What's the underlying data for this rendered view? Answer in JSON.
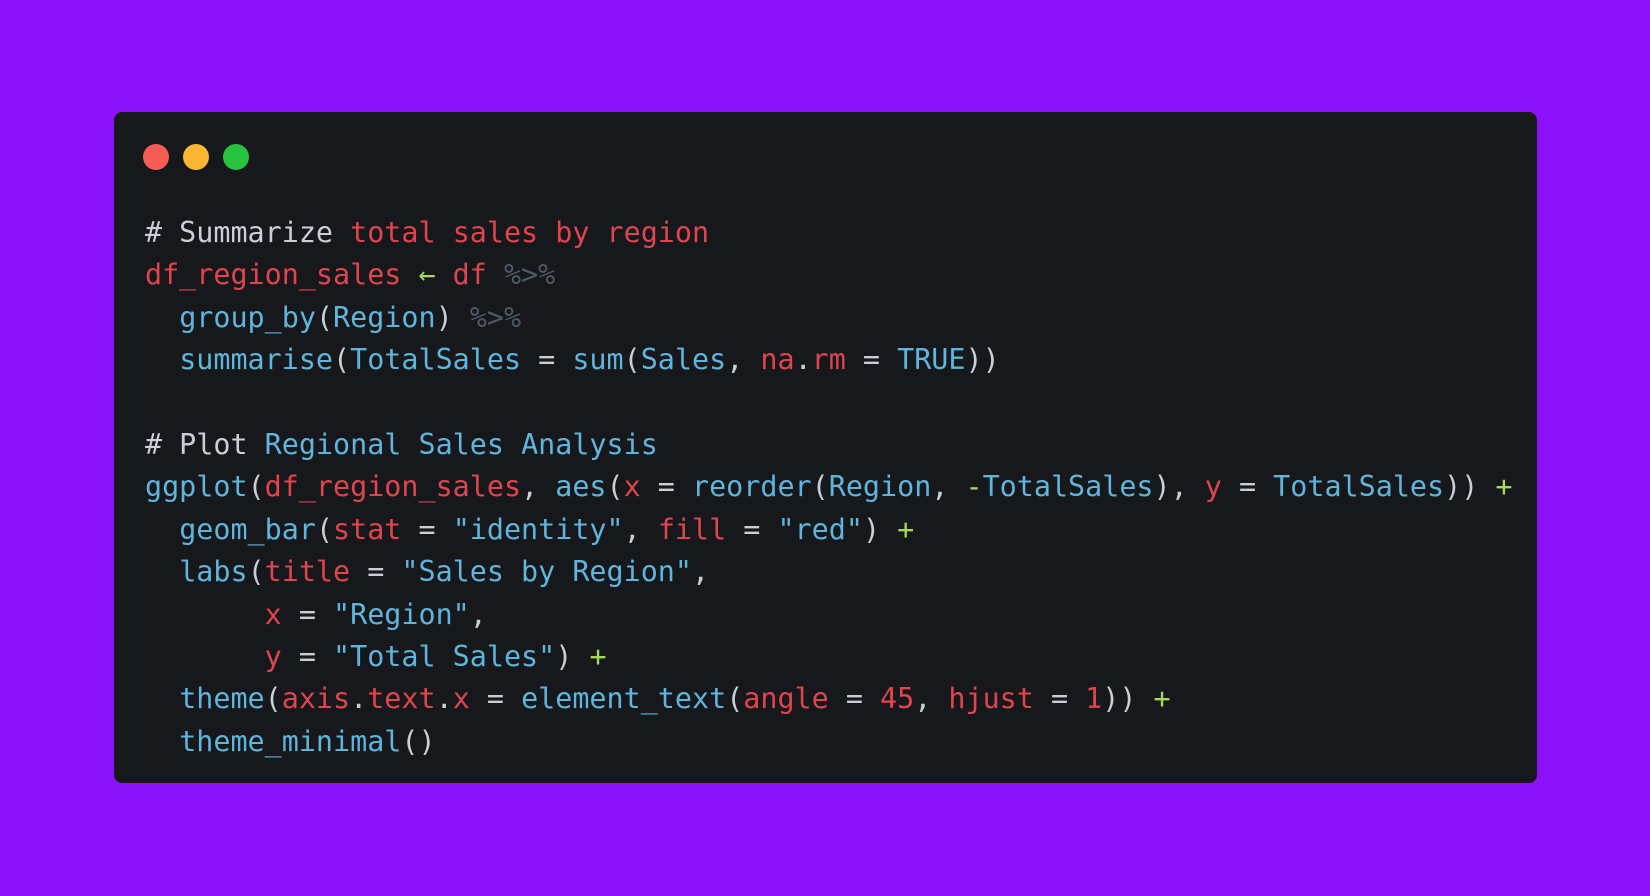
{
  "colors": {
    "background": "#8b12fb",
    "window": "#16181b",
    "dot_close": "#f85d55",
    "dot_minimize": "#fbb633",
    "dot_zoom": "#27c33f",
    "default": "#c9cfd8",
    "red": "#e0454f",
    "blue": "#5fb5dc",
    "green": "#a6d85a",
    "pipe": "#4e5b66"
  },
  "window_controls": {
    "close_icon": "red-circle",
    "minimize_icon": "yellow-circle",
    "zoom_icon": "green-circle"
  },
  "code_lines": [
    [
      {
        "t": "# Summarize ",
        "c": "default"
      },
      {
        "t": "total",
        "c": "red"
      },
      {
        "t": " ",
        "c": "default"
      },
      {
        "t": "sales",
        "c": "red"
      },
      {
        "t": " ",
        "c": "default"
      },
      {
        "t": "by",
        "c": "red"
      },
      {
        "t": " ",
        "c": "default"
      },
      {
        "t": "region",
        "c": "red"
      }
    ],
    [
      {
        "t": "df_region_sales",
        "c": "red"
      },
      {
        "t": " ",
        "c": "default"
      },
      {
        "t": "←",
        "c": "green"
      },
      {
        "t": " ",
        "c": "default"
      },
      {
        "t": "df",
        "c": "red"
      },
      {
        "t": " ",
        "c": "default"
      },
      {
        "t": "%>%",
        "c": "pipe"
      }
    ],
    [
      {
        "t": "  ",
        "c": "default"
      },
      {
        "t": "group_by",
        "c": "blue"
      },
      {
        "t": "(",
        "c": "default"
      },
      {
        "t": "Region",
        "c": "blue"
      },
      {
        "t": ") ",
        "c": "default"
      },
      {
        "t": "%>%",
        "c": "pipe"
      }
    ],
    [
      {
        "t": "  ",
        "c": "default"
      },
      {
        "t": "summarise",
        "c": "blue"
      },
      {
        "t": "(",
        "c": "default"
      },
      {
        "t": "TotalSales",
        "c": "blue"
      },
      {
        "t": " = ",
        "c": "default"
      },
      {
        "t": "sum",
        "c": "blue"
      },
      {
        "t": "(",
        "c": "default"
      },
      {
        "t": "Sales",
        "c": "blue"
      },
      {
        "t": ", ",
        "c": "default"
      },
      {
        "t": "na",
        "c": "red"
      },
      {
        "t": ".",
        "c": "default"
      },
      {
        "t": "rm",
        "c": "red"
      },
      {
        "t": " = ",
        "c": "default"
      },
      {
        "t": "TRUE",
        "c": "blue"
      },
      {
        "t": "))",
        "c": "default"
      }
    ],
    [],
    [
      {
        "t": "# Plot ",
        "c": "default"
      },
      {
        "t": "Regional",
        "c": "blue"
      },
      {
        "t": " ",
        "c": "default"
      },
      {
        "t": "Sales",
        "c": "blue"
      },
      {
        "t": " ",
        "c": "default"
      },
      {
        "t": "Analysis",
        "c": "blue"
      }
    ],
    [
      {
        "t": "ggplot",
        "c": "blue"
      },
      {
        "t": "(",
        "c": "default"
      },
      {
        "t": "df_region_sales",
        "c": "red"
      },
      {
        "t": ", ",
        "c": "default"
      },
      {
        "t": "aes",
        "c": "blue"
      },
      {
        "t": "(",
        "c": "default"
      },
      {
        "t": "x",
        "c": "red"
      },
      {
        "t": " = ",
        "c": "default"
      },
      {
        "t": "reorder",
        "c": "blue"
      },
      {
        "t": "(",
        "c": "default"
      },
      {
        "t": "Region",
        "c": "blue"
      },
      {
        "t": ", ",
        "c": "default"
      },
      {
        "t": "-",
        "c": "green"
      },
      {
        "t": "TotalSales",
        "c": "blue"
      },
      {
        "t": "), ",
        "c": "default"
      },
      {
        "t": "y",
        "c": "red"
      },
      {
        "t": " = ",
        "c": "default"
      },
      {
        "t": "TotalSales",
        "c": "blue"
      },
      {
        "t": ")) ",
        "c": "default"
      },
      {
        "t": "+",
        "c": "green"
      }
    ],
    [
      {
        "t": "  ",
        "c": "default"
      },
      {
        "t": "geom_bar",
        "c": "blue"
      },
      {
        "t": "(",
        "c": "default"
      },
      {
        "t": "stat",
        "c": "red"
      },
      {
        "t": " = ",
        "c": "default"
      },
      {
        "t": "\"identity\"",
        "c": "blue"
      },
      {
        "t": ", ",
        "c": "default"
      },
      {
        "t": "fill",
        "c": "red"
      },
      {
        "t": " = ",
        "c": "default"
      },
      {
        "t": "\"red\"",
        "c": "blue"
      },
      {
        "t": ") ",
        "c": "default"
      },
      {
        "t": "+",
        "c": "green"
      }
    ],
    [
      {
        "t": "  ",
        "c": "default"
      },
      {
        "t": "labs",
        "c": "blue"
      },
      {
        "t": "(",
        "c": "default"
      },
      {
        "t": "title",
        "c": "red"
      },
      {
        "t": " = ",
        "c": "default"
      },
      {
        "t": "\"Sales by Region\"",
        "c": "blue"
      },
      {
        "t": ",",
        "c": "default"
      }
    ],
    [
      {
        "t": "       ",
        "c": "default"
      },
      {
        "t": "x",
        "c": "red"
      },
      {
        "t": " = ",
        "c": "default"
      },
      {
        "t": "\"Region\"",
        "c": "blue"
      },
      {
        "t": ",",
        "c": "default"
      }
    ],
    [
      {
        "t": "       ",
        "c": "default"
      },
      {
        "t": "y",
        "c": "red"
      },
      {
        "t": " = ",
        "c": "default"
      },
      {
        "t": "\"Total Sales\"",
        "c": "blue"
      },
      {
        "t": ") ",
        "c": "default"
      },
      {
        "t": "+",
        "c": "green"
      }
    ],
    [
      {
        "t": "  ",
        "c": "default"
      },
      {
        "t": "theme",
        "c": "blue"
      },
      {
        "t": "(",
        "c": "default"
      },
      {
        "t": "axis",
        "c": "red"
      },
      {
        "t": ".",
        "c": "default"
      },
      {
        "t": "text",
        "c": "red"
      },
      {
        "t": ".",
        "c": "default"
      },
      {
        "t": "x",
        "c": "red"
      },
      {
        "t": " = ",
        "c": "default"
      },
      {
        "t": "element_text",
        "c": "blue"
      },
      {
        "t": "(",
        "c": "default"
      },
      {
        "t": "angle",
        "c": "red"
      },
      {
        "t": " = ",
        "c": "default"
      },
      {
        "t": "45",
        "c": "red"
      },
      {
        "t": ", ",
        "c": "default"
      },
      {
        "t": "hjust",
        "c": "red"
      },
      {
        "t": " = ",
        "c": "default"
      },
      {
        "t": "1",
        "c": "red"
      },
      {
        "t": ")) ",
        "c": "default"
      },
      {
        "t": "+",
        "c": "green"
      }
    ],
    [
      {
        "t": "  ",
        "c": "default"
      },
      {
        "t": "theme_minimal",
        "c": "blue"
      },
      {
        "t": "()",
        "c": "default"
      }
    ]
  ]
}
